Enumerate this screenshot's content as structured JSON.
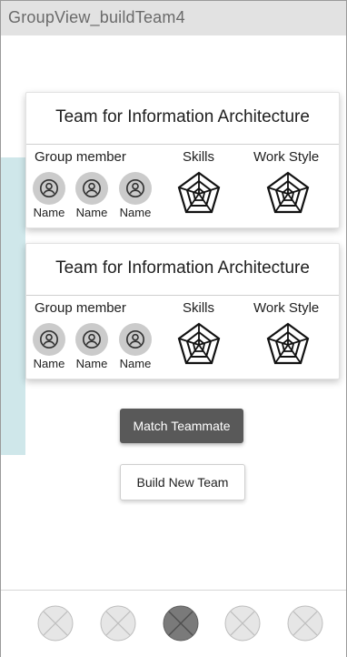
{
  "window": {
    "title": "GroupView_buildTeam4"
  },
  "teams": [
    {
      "title": "Team for Information Architecture",
      "group_member_label": "Group member",
      "skills_label": "Skills",
      "work_style_label": "Work Style",
      "members": [
        {
          "name": "Name"
        },
        {
          "name": "Name"
        },
        {
          "name": "Name"
        }
      ]
    },
    {
      "title": "Team for Information Architecture",
      "group_member_label": "Group member",
      "skills_label": "Skills",
      "work_style_label": "Work Style",
      "members": [
        {
          "name": "Name"
        },
        {
          "name": "Name"
        },
        {
          "name": "Name"
        }
      ]
    }
  ],
  "actions": {
    "match_label": "Match Teammate",
    "build_label": "Build New Team"
  },
  "bottom_nav": {
    "items": [
      {
        "icon": "placeholder-icon",
        "selected": false
      },
      {
        "icon": "placeholder-icon",
        "selected": false
      },
      {
        "icon": "placeholder-icon",
        "selected": true
      },
      {
        "icon": "placeholder-icon",
        "selected": false
      },
      {
        "icon": "placeholder-icon",
        "selected": false
      }
    ]
  },
  "colors": {
    "accent": "#595959",
    "strip": "#cfe7ea",
    "titlebar": "#e2e2e2",
    "avatar": "#cbcbcb"
  }
}
